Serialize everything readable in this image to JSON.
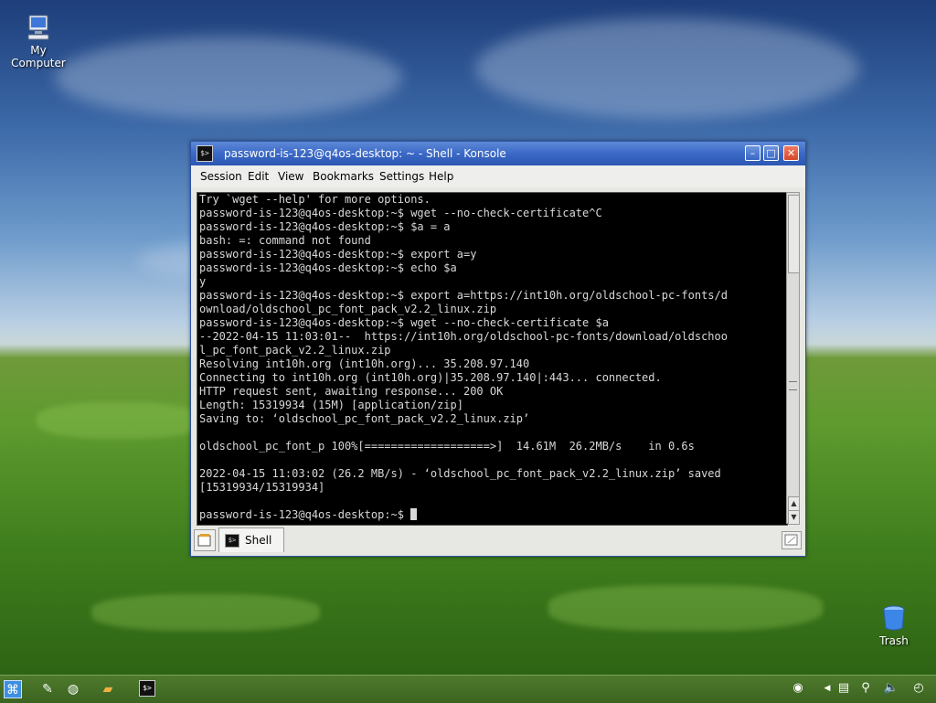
{
  "desktop": {
    "icons": [
      {
        "label_line1": "My",
        "label_line2": "Computer"
      },
      {
        "label_line1": "Trash"
      }
    ]
  },
  "window": {
    "title": "password-is-123@q4os-desktop: ~ - Shell - Konsole",
    "menu": [
      "Session",
      "Edit",
      "View",
      "Bookmarks",
      "Settings",
      "Help"
    ],
    "terminal_lines": [
      "Try `wget --help' for more options.",
      "password-is-123@q4os-desktop:~$ wget --no-check-certificate^C",
      "password-is-123@q4os-desktop:~$ $a = a",
      "bash: =: command not found",
      "password-is-123@q4os-desktop:~$ export a=y",
      "password-is-123@q4os-desktop:~$ echo $a",
      "y",
      "password-is-123@q4os-desktop:~$ export a=https://int10h.org/oldschool-pc-fonts/d",
      "ownload/oldschool_pc_font_pack_v2.2_linux.zip",
      "password-is-123@q4os-desktop:~$ wget --no-check-certificate $a",
      "--2022-04-15 11:03:01--  https://int10h.org/oldschool-pc-fonts/download/oldschoo",
      "l_pc_font_pack_v2.2_linux.zip",
      "Resolving int10h.org (int10h.org)... 35.208.97.140",
      "Connecting to int10h.org (int10h.org)|35.208.97.140|:443... connected.",
      "HTTP request sent, awaiting response... 200 OK",
      "Length: 15319934 (15M) [application/zip]",
      "Saving to: ‘oldschool_pc_font_pack_v2.2_linux.zip’",
      "",
      "oldschool_pc_font_p 100%[===================>]  14.61M  26.2MB/s    in 0.6s",
      "",
      "2022-04-15 11:03:02 (26.2 MB/s) - ‘oldschool_pc_font_pack_v2.2_linux.zip’ saved",
      "[15319934/15319934]",
      "",
      "password-is-123@q4os-desktop:~$ "
    ],
    "tab_label": "Shell"
  }
}
